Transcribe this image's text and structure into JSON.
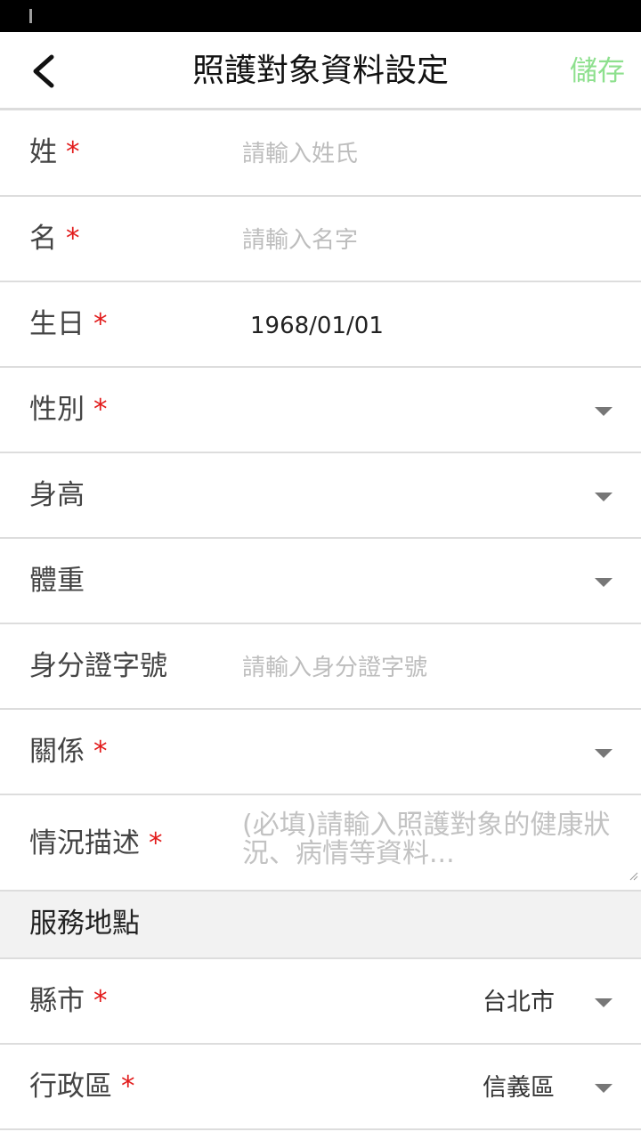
{
  "header": {
    "title": "照護對象資料設定",
    "save_label": "儲存"
  },
  "colors": {
    "accent": "#8ee08e",
    "required": "#e21b1b"
  },
  "icons": {
    "back": "chevron-left-icon",
    "dropdown": "caret-down-icon"
  },
  "form": {
    "surname": {
      "label": "姓",
      "required": "*",
      "placeholder": "請輸入姓氏"
    },
    "given_name": {
      "label": "名",
      "required": "*",
      "placeholder": "請輸入名字"
    },
    "birthday": {
      "label": "生日",
      "required": "*",
      "value": "1968/01/01"
    },
    "gender": {
      "label": "性別",
      "required": "*"
    },
    "height": {
      "label": "身高"
    },
    "weight": {
      "label": "體重"
    },
    "id_number": {
      "label": "身分證字號",
      "placeholder": "請輸入身分證字號"
    },
    "relation": {
      "label": "關係",
      "required": "*"
    },
    "condition": {
      "label": "情況描述",
      "required": "*",
      "placeholder": "(必填)請輸入照護對象的健康狀況、病情等資料..."
    }
  },
  "service_location": {
    "title": "服務地點",
    "city": {
      "label": "縣市",
      "required": "*",
      "value": "台北市"
    },
    "district": {
      "label": "行政區",
      "required": "*",
      "value": "信義區"
    }
  }
}
